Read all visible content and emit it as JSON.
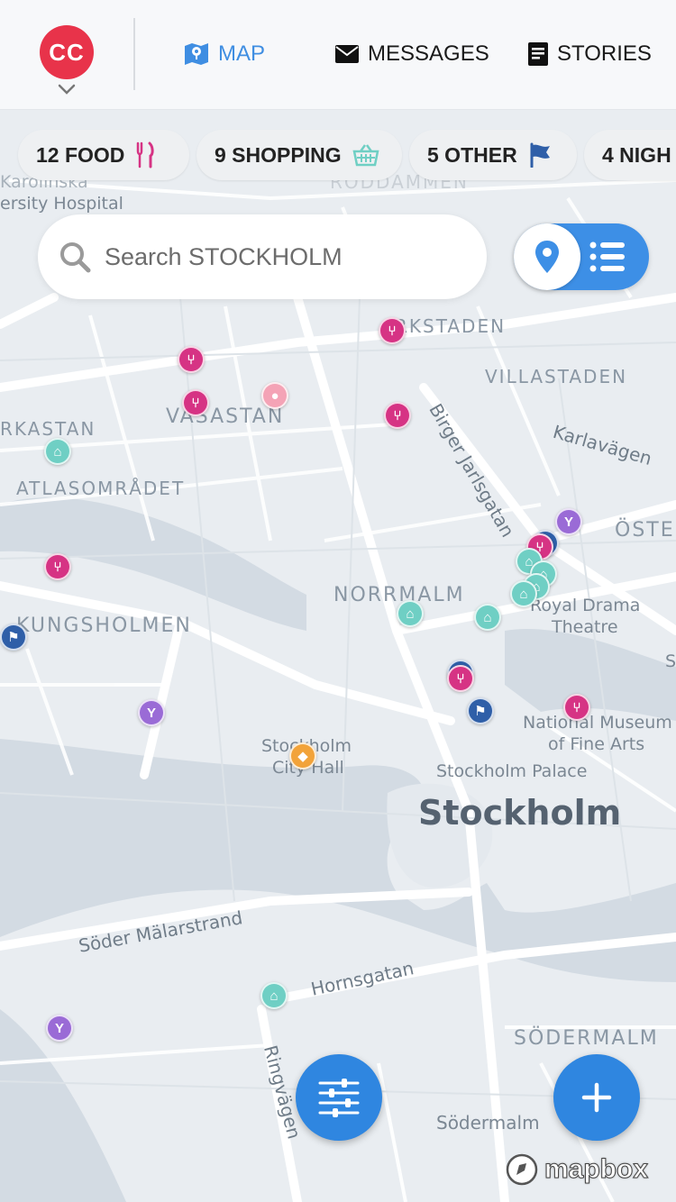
{
  "header": {
    "logo_text": "CC",
    "tabs": [
      {
        "label": "MAP",
        "icon": "map-icon",
        "active": true
      },
      {
        "label": "MESSAGES",
        "icon": "envelope-icon",
        "active": false
      },
      {
        "label": "STORIES",
        "icon": "document-icon",
        "active": false
      }
    ]
  },
  "chips": [
    {
      "label": "12 FOOD",
      "icon": "fork-knife-icon",
      "icon_color": "#d63384"
    },
    {
      "label": "9 SHOPPING",
      "icon": "basket-icon",
      "icon_color": "#6fcfc4"
    },
    {
      "label": "5 OTHER",
      "icon": "flag-icon",
      "icon_color": "#2f5fa8"
    },
    {
      "label": "4 NIGH",
      "icon": "",
      "icon_color": ""
    }
  ],
  "search": {
    "placeholder": "Search STOCKHOLM"
  },
  "map": {
    "districts": [
      "RKSTADEN",
      "VILLASTADEN",
      "VASASTAN",
      "RKASTAN",
      "ATLASOMRÅDET",
      "NORRMALM",
      "KUNGSHOLMEN",
      "ÖSTE",
      "SÖDERMALM",
      "RODDAMMEN"
    ],
    "streets": [
      "Birger Jarlsgatan",
      "Karlavägen",
      "Söder Mälarstrand",
      "Hornsgatan",
      "Ringvägen"
    ],
    "pois": [
      "Karolinska",
      "ersity Hospital",
      "Royal Drama",
      "Theatre",
      "National Museum",
      "of Fine Arts",
      "Stockholm",
      "City Hall",
      "Stockholm Palace",
      "Södermalm",
      "S"
    ],
    "city": "Stockholm",
    "attribution": "mapbox"
  },
  "colors": {
    "accent": "#3d8fe6",
    "logo": "#e8334a",
    "food": "#d63384",
    "shopping": "#6fcfc4",
    "nightlife": "#9a6bd6",
    "other": "#2f5fa8"
  }
}
